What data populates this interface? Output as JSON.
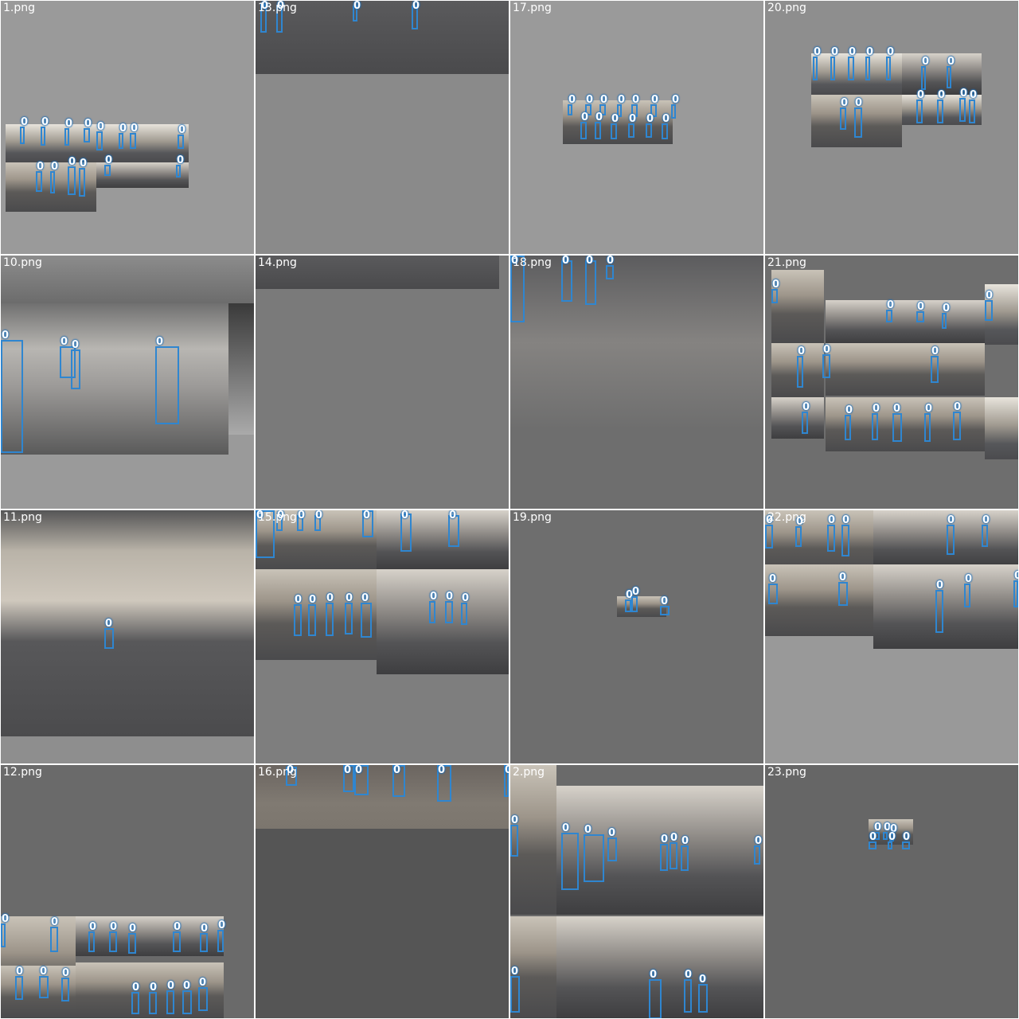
{
  "box_color": "#2f86d0",
  "class_label": "0",
  "tiles": [
    {
      "name": "1.png",
      "bg": "#9a9a9a"
    },
    {
      "name": "13.png",
      "bg": "#8a8a8a"
    },
    {
      "name": "17.png",
      "bg": "#9a9a9a"
    },
    {
      "name": "20.png",
      "bg": "#8e8e8e"
    },
    {
      "name": "10.png",
      "bg": "#9a9a9a"
    },
    {
      "name": "14.png",
      "bg": "#7a7a7a"
    },
    {
      "name": "18.png",
      "bg": "#6e6e6e"
    },
    {
      "name": "21.png",
      "bg": "#6e6e6e"
    },
    {
      "name": "11.png",
      "bg": "#8e8e8e"
    },
    {
      "name": "15.png",
      "bg": "#7e7e7e"
    },
    {
      "name": "19.png",
      "bg": "#6e6e6e"
    },
    {
      "name": "22.png",
      "bg": "#999999"
    },
    {
      "name": "12.png",
      "bg": "#6a6a6a"
    },
    {
      "name": "16.png",
      "bg": "#555555"
    },
    {
      "name": "2.png",
      "bg": "#6a6a6a"
    },
    {
      "name": "23.png",
      "bg": "#666666"
    }
  ]
}
